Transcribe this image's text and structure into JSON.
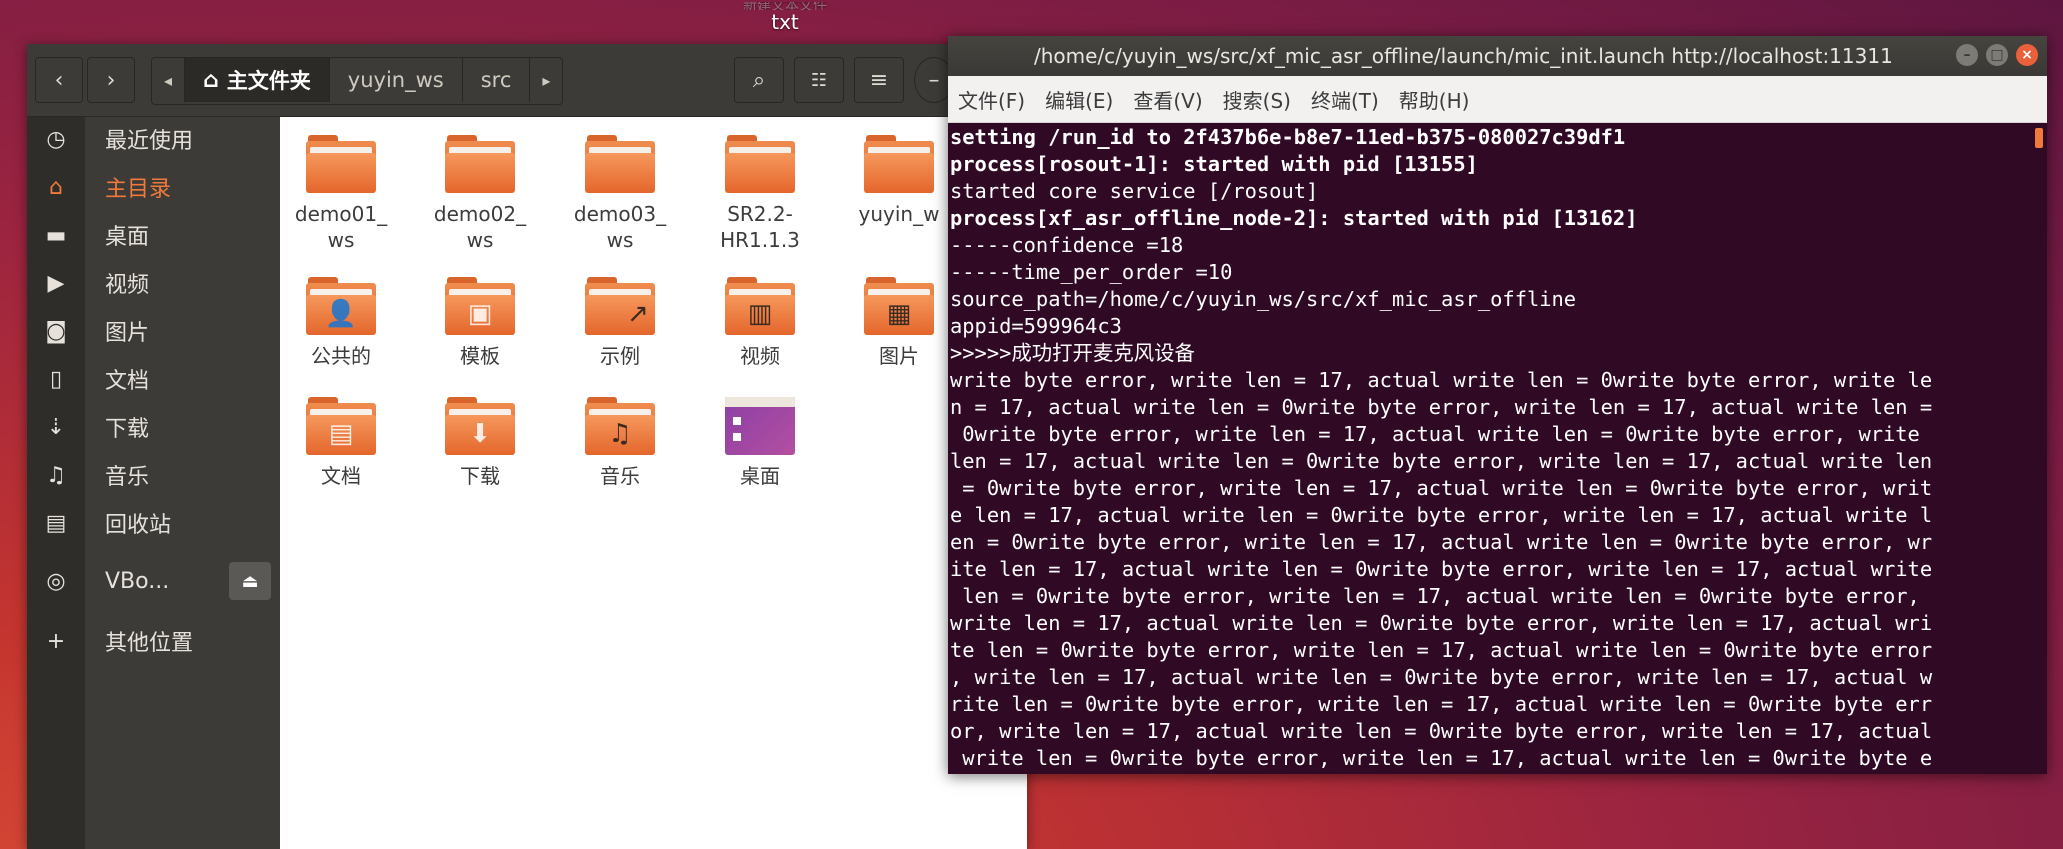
{
  "desktop": {
    "file_label": "txt",
    "file_label_above": "新建文本文件"
  },
  "file_manager": {
    "nav": {
      "back": "‹",
      "forward": "›",
      "path_left": "◂",
      "path_right": "▸"
    },
    "breadcrumbs": [
      "主目录",
      "yuyin_ws",
      "src"
    ],
    "home_crumb": "主文件夹",
    "sidebar": [
      {
        "label": "最近使用",
        "icon": "clock-icon"
      },
      {
        "label": "主目录",
        "icon": "home-icon"
      },
      {
        "label": "桌面",
        "icon": "folder-icon"
      },
      {
        "label": "视频",
        "icon": "video-icon"
      },
      {
        "label": "图片",
        "icon": "camera-icon"
      },
      {
        "label": "文档",
        "icon": "document-icon"
      },
      {
        "label": "下载",
        "icon": "download-icon"
      },
      {
        "label": "音乐",
        "icon": "music-icon"
      },
      {
        "label": "回收站",
        "icon": "trash-icon"
      },
      {
        "label": "VBo...",
        "icon": "disc-icon"
      },
      {
        "label": "其他位置",
        "icon": "plus-icon"
      }
    ],
    "items": [
      {
        "label": "demo01_\nws",
        "icon": "folder"
      },
      {
        "label": "demo02_\nws",
        "icon": "folder"
      },
      {
        "label": "demo03_\nws",
        "icon": "folder"
      },
      {
        "label": "SR2.2-\nHR1.1.3",
        "icon": "folder"
      },
      {
        "label": "yuyin_w",
        "icon": "folder"
      },
      {
        "label": "公共的",
        "icon": "folder-public"
      },
      {
        "label": "模板",
        "icon": "folder-templates"
      },
      {
        "label": "示例",
        "icon": "folder-examples"
      },
      {
        "label": "视频",
        "icon": "folder-videos"
      },
      {
        "label": "图片",
        "icon": "folder-pictures"
      },
      {
        "label": "文档",
        "icon": "folder-documents"
      },
      {
        "label": "下载",
        "icon": "folder-downloads"
      },
      {
        "label": "音乐",
        "icon": "folder-music"
      },
      {
        "label": "桌面",
        "icon": "desktop"
      }
    ]
  },
  "terminal": {
    "title": "/home/c/yuyin_ws/src/xf_mic_asr_offline/launch/mic_init.launch http://localhost:11311",
    "menu": [
      "文件(F)",
      "编辑(E)",
      "查看(V)",
      "搜索(S)",
      "终端(T)",
      "帮助(H)"
    ],
    "lines": [
      {
        "text": "setting /run_id to 2f437b6e-b8e7-11ed-b375-080027c39df1",
        "bold": true
      },
      {
        "text": "process[rosout-1]: started with pid [13155]",
        "bold": true
      },
      {
        "text": "started core service [/rosout]",
        "bold": false
      },
      {
        "text": "process[xf_asr_offline_node-2]: started with pid [13162]",
        "bold": true
      },
      {
        "text": "-----confidence =18",
        "bold": false
      },
      {
        "text": "-----time_per_order =10",
        "bold": false
      },
      {
        "text": "source_path=/home/c/yuyin_ws/src/xf_mic_asr_offline",
        "bold": false
      },
      {
        "text": "appid=599964c3",
        "bold": false
      },
      {
        "text": ">>>>>成功打开麦克风设备",
        "bold": false
      },
      {
        "text": "write byte error, write len = 17, actual write len = 0write byte error, write le",
        "bold": false
      },
      {
        "text": "n = 17, actual write len = 0write byte error, write len = 17, actual write len =",
        "bold": false
      },
      {
        "text": " 0write byte error, write len = 17, actual write len = 0write byte error, write",
        "bold": false
      },
      {
        "text": "len = 17, actual write len = 0write byte error, write len = 17, actual write len",
        "bold": false
      },
      {
        "text": " = 0write byte error, write len = 17, actual write len = 0write byte error, writ",
        "bold": false
      },
      {
        "text": "e len = 17, actual write len = 0write byte error, write len = 17, actual write l",
        "bold": false
      },
      {
        "text": "en = 0write byte error, write len = 17, actual write len = 0write byte error, wr",
        "bold": false
      },
      {
        "text": "ite len = 17, actual write len = 0write byte error, write len = 17, actual write",
        "bold": false
      },
      {
        "text": " len = 0write byte error, write len = 17, actual write len = 0write byte error,",
        "bold": false
      },
      {
        "text": "write len = 17, actual write len = 0write byte error, write len = 17, actual wri",
        "bold": false
      },
      {
        "text": "te len = 0write byte error, write len = 17, actual write len = 0write byte error",
        "bold": false
      },
      {
        "text": ", write len = 17, actual write len = 0write byte error, write len = 17, actual w",
        "bold": false
      },
      {
        "text": "rite len = 0write byte error, write len = 17, actual write len = 0write byte err",
        "bold": false
      },
      {
        "text": "or, write len = 17, actual write len = 0write byte error, write len = 17, actual",
        "bold": false
      },
      {
        "text": " write len = 0write byte error, write len = 17, actual write len = 0write byte e",
        "bold": false
      }
    ]
  }
}
